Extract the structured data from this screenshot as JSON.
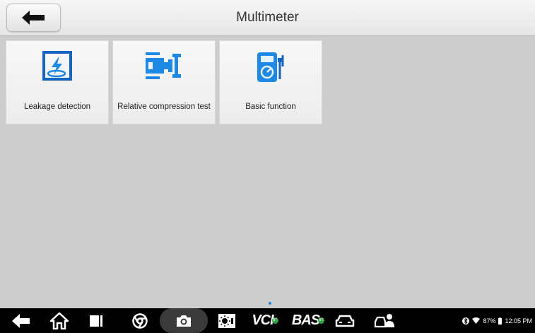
{
  "header": {
    "title": "Multimeter"
  },
  "tiles": [
    {
      "label": "Leakage detection",
      "icon": "leakage-detection-icon"
    },
    {
      "label": "Relative compression test",
      "icon": "relative-compression-icon"
    },
    {
      "label": "Basic function",
      "icon": "multimeter-icon"
    }
  ],
  "navbar": {
    "vci_label": "VCI",
    "bas_label": "BAS",
    "bt_badge": "BT"
  },
  "status": {
    "battery": "87%",
    "time": "12:05 PM"
  },
  "colors": {
    "accent": "#1e88e5"
  }
}
